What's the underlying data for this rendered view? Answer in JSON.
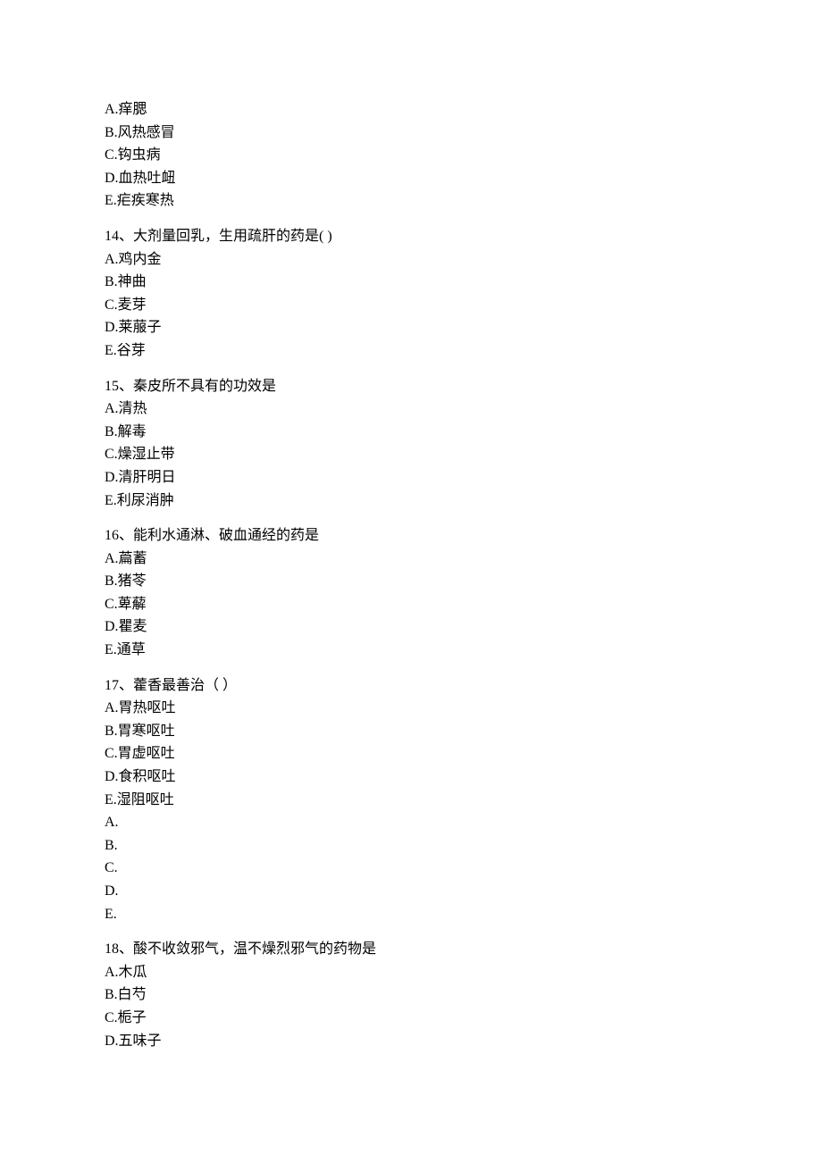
{
  "questions": [
    {
      "number": "",
      "stem": "",
      "options": [
        "A.痒腮",
        "B.风热感冒",
        "C.钩虫病",
        "D.血热吐衄",
        "E.疟疾寒热"
      ]
    },
    {
      "number": "14、",
      "stem": "大剂量回乳，生用疏肝的药是( )",
      "options": [
        "A.鸡内金",
        "B.神曲",
        "C.麦芽",
        "D.莱菔子",
        "E.谷芽"
      ]
    },
    {
      "number": "15、",
      "stem": "秦皮所不具有的功效是",
      "options": [
        "A.清热",
        "B.解毒",
        "C.燥湿止带",
        "D.清肝明日",
        "E.利尿消肿"
      ]
    },
    {
      "number": "16、",
      "stem": "能利水通淋、破血通经的药是",
      "options": [
        "A.萹蓄",
        "B.猪苓",
        "C.萆薢",
        "D.瞿麦",
        "E.通草"
      ]
    },
    {
      "number": "17、",
      "stem": "藿香最善治（  ）",
      "options": [
        "A.胃热呕吐",
        "B.胃寒呕吐",
        "C.胃虚呕吐",
        "D.食积呕吐",
        "E.湿阻呕吐",
        "A.",
        "B.",
        "C.",
        "D.",
        "E."
      ]
    },
    {
      "number": "18、",
      "stem": "酸不收敛邪气，温不燥烈邪气的药物是",
      "options": [
        "A.木瓜",
        "B.白芍",
        "C.栀子",
        "D.五味子"
      ]
    }
  ]
}
